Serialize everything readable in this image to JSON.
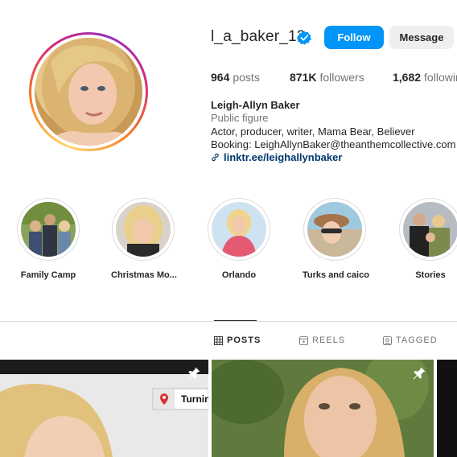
{
  "profile": {
    "username": "l_a_baker_13",
    "verified_icon": "verified-badge-icon",
    "follow_label": "Follow",
    "message_label": "Message"
  },
  "stats": {
    "posts_count": "964",
    "posts_label": "posts",
    "followers_count": "871K",
    "followers_label": "followers",
    "following_count": "1,682",
    "following_label": "following"
  },
  "bio": {
    "name": "Leigh-Allyn Baker",
    "category": "Public figure",
    "line1": "Actor, producer, writer, Mama Bear, Believer",
    "line2": "Booking: LeighAllynBaker@theanthemcollective.com",
    "link": "linktr.ee/leighallynbaker"
  },
  "highlights": [
    {
      "label": "Family Camp"
    },
    {
      "label": "Christmas Mo..."
    },
    {
      "label": "Orlando"
    },
    {
      "label": "Turks and caico"
    },
    {
      "label": "Stories"
    }
  ],
  "tabs": [
    {
      "label": "POSTS",
      "icon": "grid-icon",
      "active": true
    },
    {
      "label": "REELS",
      "icon": "reels-icon",
      "active": false
    },
    {
      "label": "TAGGED",
      "icon": "tagged-icon",
      "active": false
    }
  ],
  "posts": [
    {
      "overlay_text": "Turnin",
      "pinned": true
    },
    {
      "pinned": true
    }
  ],
  "colors": {
    "accent": "#0095f6",
    "link": "#00376b",
    "secondary_text": "#737373"
  }
}
